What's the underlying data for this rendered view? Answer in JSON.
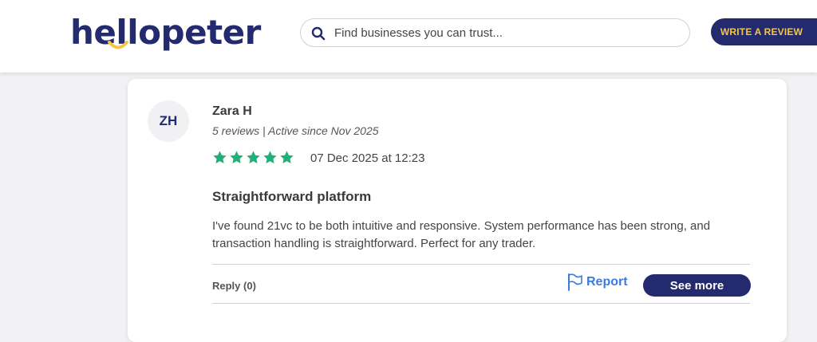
{
  "header": {
    "logo_text": "hellopeter",
    "search_placeholder": "Find businesses you can trust...",
    "write_review_label": "WRITE A REVIEW"
  },
  "review": {
    "avatar_initials": "ZH",
    "reviewer_name": "Zara H",
    "reviewer_meta": "5 reviews | Active since Nov 2025",
    "rating": 5,
    "rating_max": 5,
    "date": "07 Dec 2025 at 12:23",
    "title": "Straightforward platform",
    "body": "I've found 21vc to be both intuitive and responsive. System performance has been strong, and transaction handling is straightforward. Perfect for any trader.",
    "reply_label": "Reply (0)",
    "report_label": "Report",
    "see_more_label": "See more"
  },
  "colors": {
    "brand_navy": "#232b6e",
    "brand_yellow": "#f6c642",
    "star_green": "#22b07a",
    "report_blue": "#3b7be0"
  },
  "icons": [
    "search-icon",
    "star-icon",
    "flag-icon",
    "smile-logo-icon"
  ]
}
